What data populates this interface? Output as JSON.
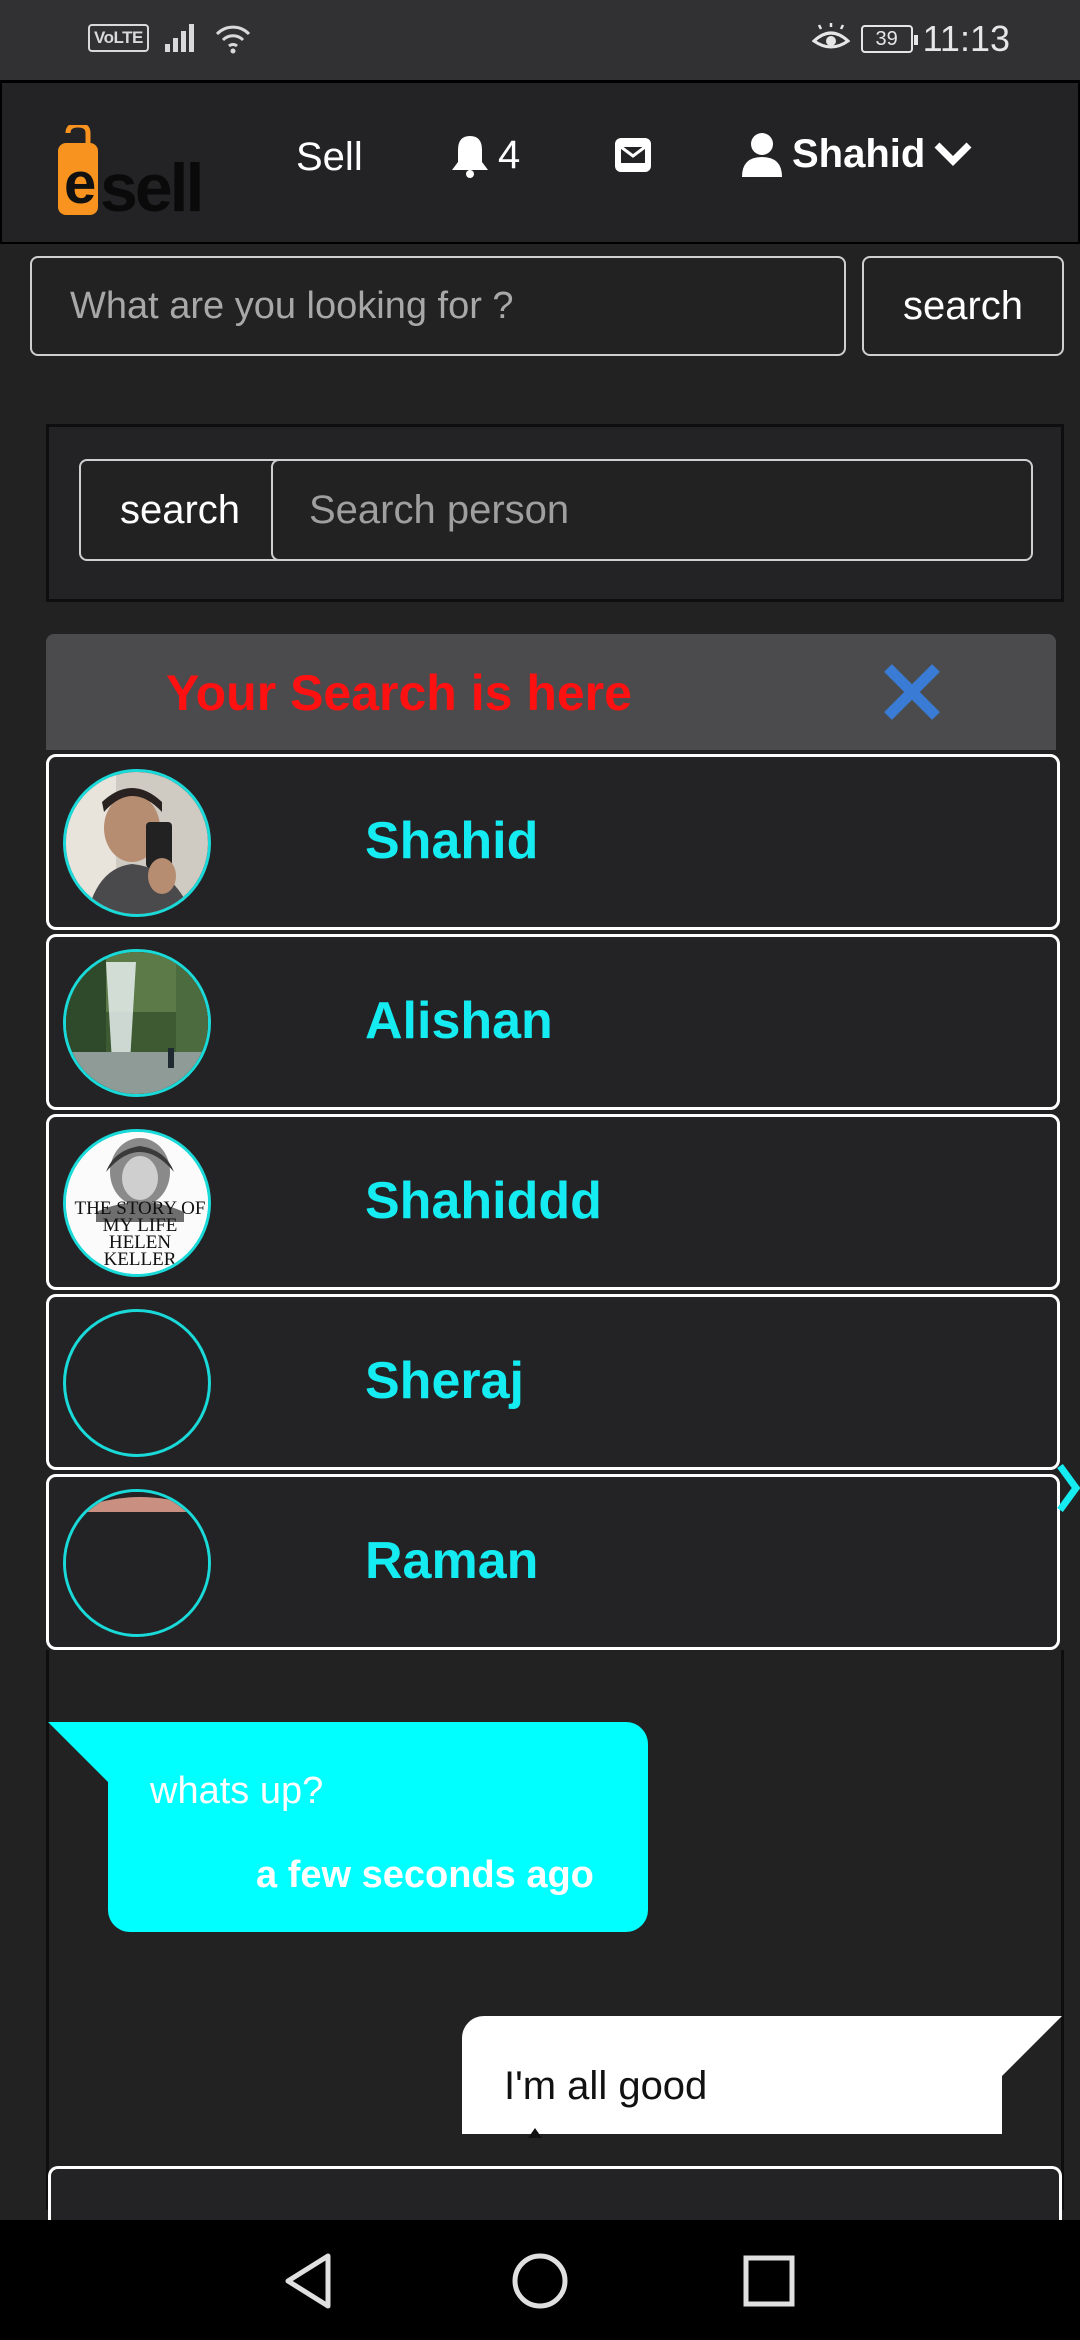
{
  "status_bar": {
    "volte": "VoLTE",
    "battery": "39",
    "time": "11:13"
  },
  "navbar": {
    "logo_text": "esell",
    "sell_label": "Sell",
    "notifications_count": "4",
    "user_name": "Shahid"
  },
  "top_search": {
    "placeholder": "What are you looking for ?",
    "button_label": "search"
  },
  "person_search": {
    "button_label": "search",
    "placeholder": "Search person"
  },
  "results": {
    "title": "Your Search is here",
    "people": [
      {
        "name": "Shahid",
        "avatar": "photo-selfie"
      },
      {
        "name": "Alishan",
        "avatar": "photo-waterfall"
      },
      {
        "name": "Shahiddd",
        "avatar": "photo-book-cover"
      },
      {
        "name": "Sheraj",
        "avatar": "empty"
      },
      {
        "name": "Raman",
        "avatar": "partial-photo"
      }
    ],
    "book_cover_text": "THE STORY OF MY LIFE HELEN KELLER"
  },
  "chat": {
    "incoming": {
      "text": "whats up?",
      "time": "a few seconds ago"
    },
    "outgoing": {
      "text": "I'm all good"
    }
  },
  "colors": {
    "accent_cyan": "#14ecf2",
    "bubble_cyan": "#00ffff",
    "title_red": "#ff1111",
    "logo_orange": "#f7931e",
    "close_blue": "#3a7bd5",
    "background": "#222223"
  }
}
